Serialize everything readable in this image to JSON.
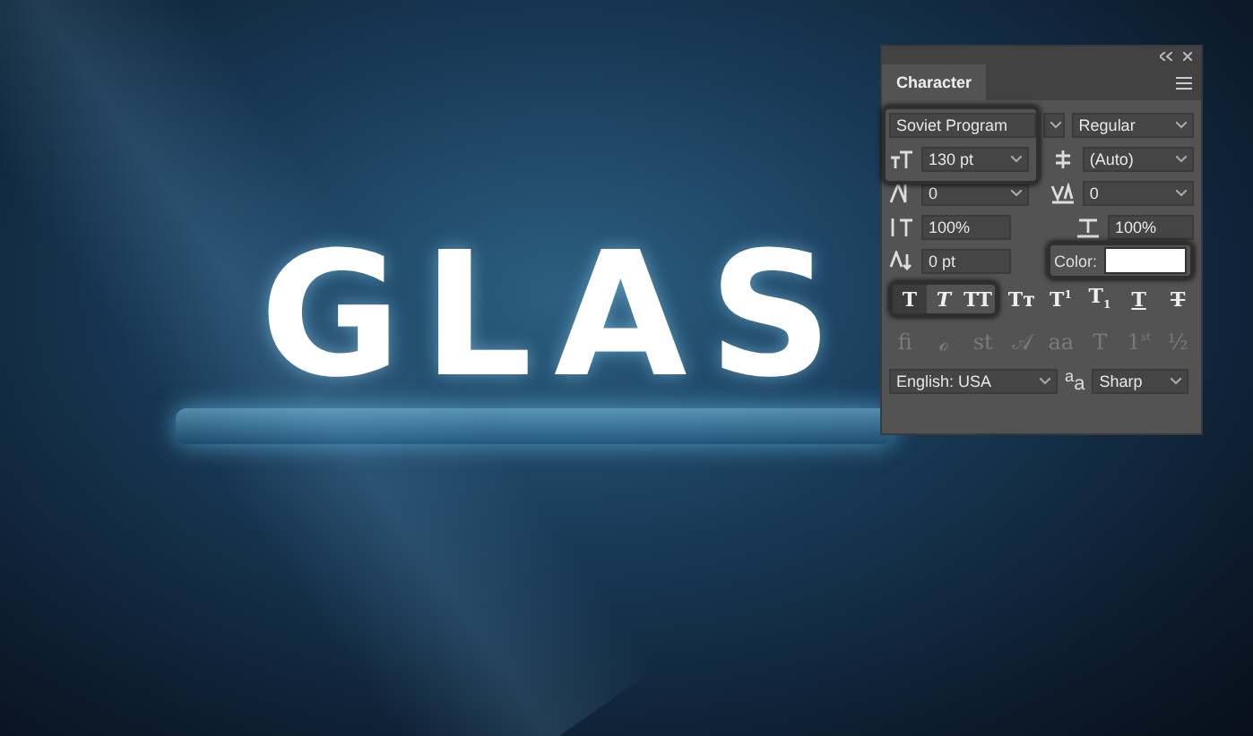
{
  "canvas": {
    "artwork_text": "GLAS"
  },
  "panel": {
    "tab": {
      "label": "Character",
      "selected": true
    },
    "font_family": {
      "value": "Soviet Program",
      "highlighted": true
    },
    "font_style": {
      "value": "Regular"
    },
    "font_size": {
      "value": "130 pt"
    },
    "leading": {
      "value": "(Auto)"
    },
    "kerning": {
      "value": "0"
    },
    "tracking": {
      "value": "0"
    },
    "vertical_scale": {
      "value": "100%"
    },
    "horizontal_scale": {
      "value": "100%"
    },
    "baseline_shift": {
      "value": "0 pt"
    },
    "color": {
      "label": "Color:",
      "color": "#ffffff",
      "highlighted": true
    },
    "type_styles": [
      {
        "label": "T",
        "kind": "bold",
        "selected": true
      },
      {
        "label": "T",
        "kind": "italic",
        "selected": false
      },
      {
        "label": "TT",
        "kind": "caps",
        "selected": false
      },
      {
        "label": "Tᴛ",
        "kind": "plain",
        "selected": false
      },
      {
        "label": "T$^{1}$",
        "kind": "plain",
        "selected": false
      },
      {
        "label": "T$_{1}$",
        "kind": "plain",
        "selected": false
      },
      {
        "label": "T",
        "kind": "underline",
        "selected": false
      },
      {
        "label": "T",
        "kind": "strike",
        "selected": false
      }
    ],
    "type_styles_highlighted": true,
    "opentype": [
      {
        "label": "fi",
        "disabled": true
      },
      {
        "label": "ℴ",
        "disabled": true
      },
      {
        "label": "st",
        "disabled": true
      },
      {
        "label": "𝒜",
        "disabled": true
      },
      {
        "label": "aa",
        "disabled": true
      },
      {
        "label": "T",
        "disabled": true
      },
      {
        "label": "1$^{st}$",
        "disabled": true
      },
      {
        "label": "½",
        "disabled": true
      }
    ],
    "language": {
      "value": "English: USA"
    },
    "antialias_label": "$^{a}$a",
    "antialias": {
      "value": "Sharp"
    }
  }
}
